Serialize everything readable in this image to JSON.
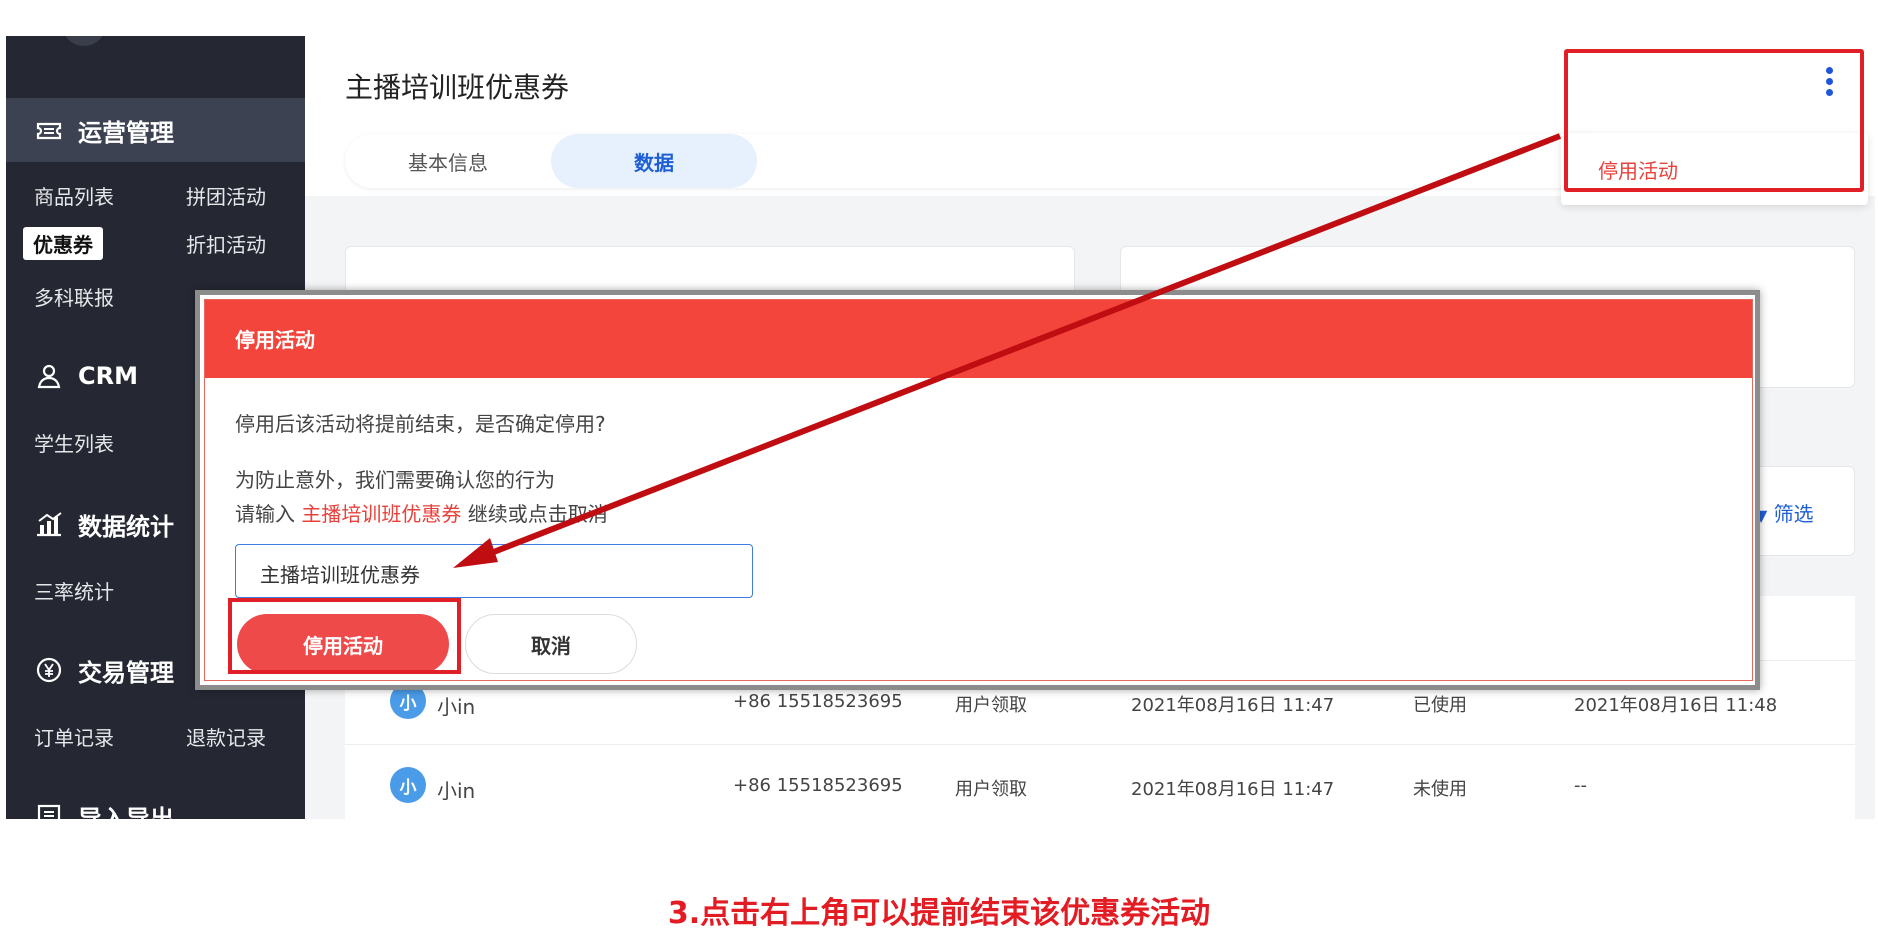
{
  "sidebar": {
    "sections": [
      {
        "label": "运营管理",
        "icon": "ticket-icon"
      },
      {
        "label": "CRM",
        "icon": "user-icon"
      },
      {
        "label": "数据统计",
        "icon": "bar-chart-icon"
      },
      {
        "label": "交易管理",
        "icon": "yen-coin-icon"
      },
      {
        "label": "导入导出",
        "icon": "import-export-icon"
      }
    ],
    "ops_items": [
      "商品列表",
      "拼团活动",
      "优惠券",
      "折扣活动",
      "多科联报"
    ],
    "crm_items": [
      "学生列表"
    ],
    "stats_items": [
      "三率统计"
    ],
    "trade_items": [
      "订单记录",
      "退款记录"
    ]
  },
  "header": {
    "title": "主播培训班优惠券",
    "tabs": [
      "基本信息",
      "数据"
    ],
    "menu_item": "停用活动"
  },
  "filter_label": "筛选",
  "table": {
    "rows": [
      {
        "avatar": "小",
        "name": "小in",
        "phone": "+86 15518523695",
        "source": "用户领取",
        "received": "2021年08月16日 11:47",
        "status": "已使用",
        "used": "2021年08月16日 11:48"
      },
      {
        "avatar": "小",
        "name": "小in",
        "phone": "+86 15518523695",
        "source": "用户领取",
        "received": "2021年08月16日 11:47",
        "status": "未使用",
        "used": "--"
      }
    ]
  },
  "dialog": {
    "title": "停用活动",
    "question": "停用后该活动将提前结束，是否确定停用?",
    "note_line1": "为防止意外，我们需要确认您的行为",
    "note_prefix": "请输入 ",
    "note_highlight": "主播培训班优惠券",
    "note_suffix": " 继续或点击取消",
    "input_value": "主播培训班优惠券",
    "confirm_label": "停用活动",
    "cancel_label": "取消"
  },
  "caption": "3.点击右上角可以提前结束该优惠券活动",
  "colors": {
    "accent_red": "#e01f26",
    "dialog_header": "#f3453b",
    "primary_blue": "#1f5fd6",
    "sidebar_bg": "#252833"
  }
}
